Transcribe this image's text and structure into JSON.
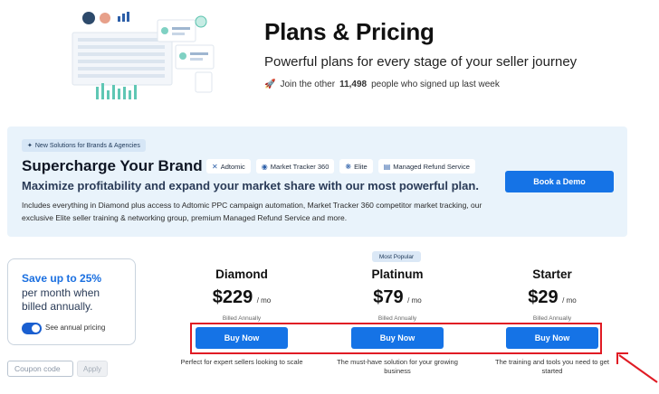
{
  "hero": {
    "title": "Plans & Pricing",
    "subtitle": "Powerful plans for every stage of your seller journey",
    "social_prefix": "Join the other",
    "social_count": "11,498",
    "social_suffix": "people who signed up last week"
  },
  "promo": {
    "badge": "New Solutions for Brands & Agencies",
    "title": "Supercharge Your Brand",
    "products": [
      {
        "label": "Adtomic",
        "icon": "adtomic-icon"
      },
      {
        "label": "Market Tracker 360",
        "icon": "market-tracker-icon"
      },
      {
        "label": "Elite",
        "icon": "elite-icon"
      },
      {
        "label": "Managed Refund Service",
        "icon": "refund-service-icon"
      }
    ],
    "headline": "Maximize profitability and expand your market share with our most powerful plan.",
    "description": "Includes everything in Diamond plus access to Adtomic PPC campaign automation, Market Tracker 360 competitor market tracking, our exclusive Elite seller training & networking group, premium Managed Refund Service and more.",
    "demo_button": "Book a Demo"
  },
  "savings": {
    "percent": "Save up to 25%",
    "text": "per month when billed annually.",
    "toggle_label": "See annual pricing",
    "toggle_on": true
  },
  "coupon": {
    "placeholder": "Coupon code",
    "apply_label": "Apply"
  },
  "popular_badge": "Most Popular",
  "plans": [
    {
      "name": "Diamond",
      "price": "$229",
      "period": "/ mo",
      "billed": "Billed Annually",
      "button": "Buy Now",
      "desc": "Perfect for expert sellers looking to scale"
    },
    {
      "name": "Platinum",
      "price": "$79",
      "period": "/ mo",
      "billed": "Billed Annually",
      "button": "Buy Now",
      "desc": "The must-have solution for your growing business"
    },
    {
      "name": "Starter",
      "price": "$29",
      "period": "/ mo",
      "billed": "Billed Annually",
      "button": "Buy Now",
      "desc": "The training and tools you need to get started"
    }
  ],
  "colors": {
    "accent": "#1573e6",
    "promo_bg": "#e9f3fb",
    "highlight": "#e01b24"
  }
}
